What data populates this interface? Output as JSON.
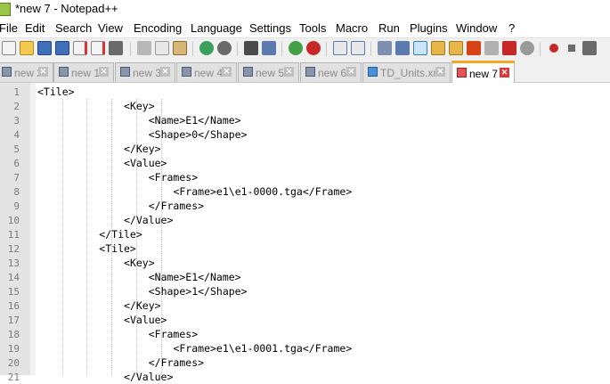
{
  "window": {
    "title": "*new 7 - Notepad++"
  },
  "menu": [
    "File",
    "Edit",
    "Search",
    "View",
    "Encoding",
    "Language",
    "Settings",
    "Tools",
    "Macro",
    "Run",
    "Plugins",
    "Window",
    "?"
  ],
  "tabs": [
    {
      "label": "new 2"
    },
    {
      "label": "new 1"
    },
    {
      "label": "new 3"
    },
    {
      "label": "new 4"
    },
    {
      "label": "new 5"
    },
    {
      "label": "new 6"
    },
    {
      "label": "TD_Units.xml"
    },
    {
      "label": "new 7"
    }
  ],
  "tab_close_glyph": "✕",
  "editor": {
    "lines": [
      {
        "num": "1",
        "text": "<Tile>"
      },
      {
        "num": "2",
        "text": "<Key>"
      },
      {
        "num": "3",
        "text": "<Name>E1</Name>"
      },
      {
        "num": "4",
        "text": "<Shape>0</Shape>"
      },
      {
        "num": "5",
        "text": "</Key>"
      },
      {
        "num": "6",
        "text": "<Value>"
      },
      {
        "num": "7",
        "text": "<Frames>"
      },
      {
        "num": "8",
        "text": "<Frame>e1\\e1-0000.tga</Frame>"
      },
      {
        "num": "9",
        "text": "</Frames>"
      },
      {
        "num": "10",
        "text": "</Value>"
      },
      {
        "num": "11",
        "text": "</Tile>"
      },
      {
        "num": "12",
        "text": "<Tile>"
      },
      {
        "num": "13",
        "text": "<Key>"
      },
      {
        "num": "14",
        "text": "<Name>E1</Name>"
      },
      {
        "num": "15",
        "text": "<Shape>1</Shape>"
      },
      {
        "num": "16",
        "text": "</Key>"
      },
      {
        "num": "17",
        "text": "<Value>"
      },
      {
        "num": "18",
        "text": "<Frames>"
      },
      {
        "num": "19",
        "text": "<Frame>e1\\e1-0001.tga</Frame>"
      },
      {
        "num": "20",
        "text": "</Frames>"
      },
      {
        "num": "21",
        "text": "</Value>"
      }
    ]
  }
}
